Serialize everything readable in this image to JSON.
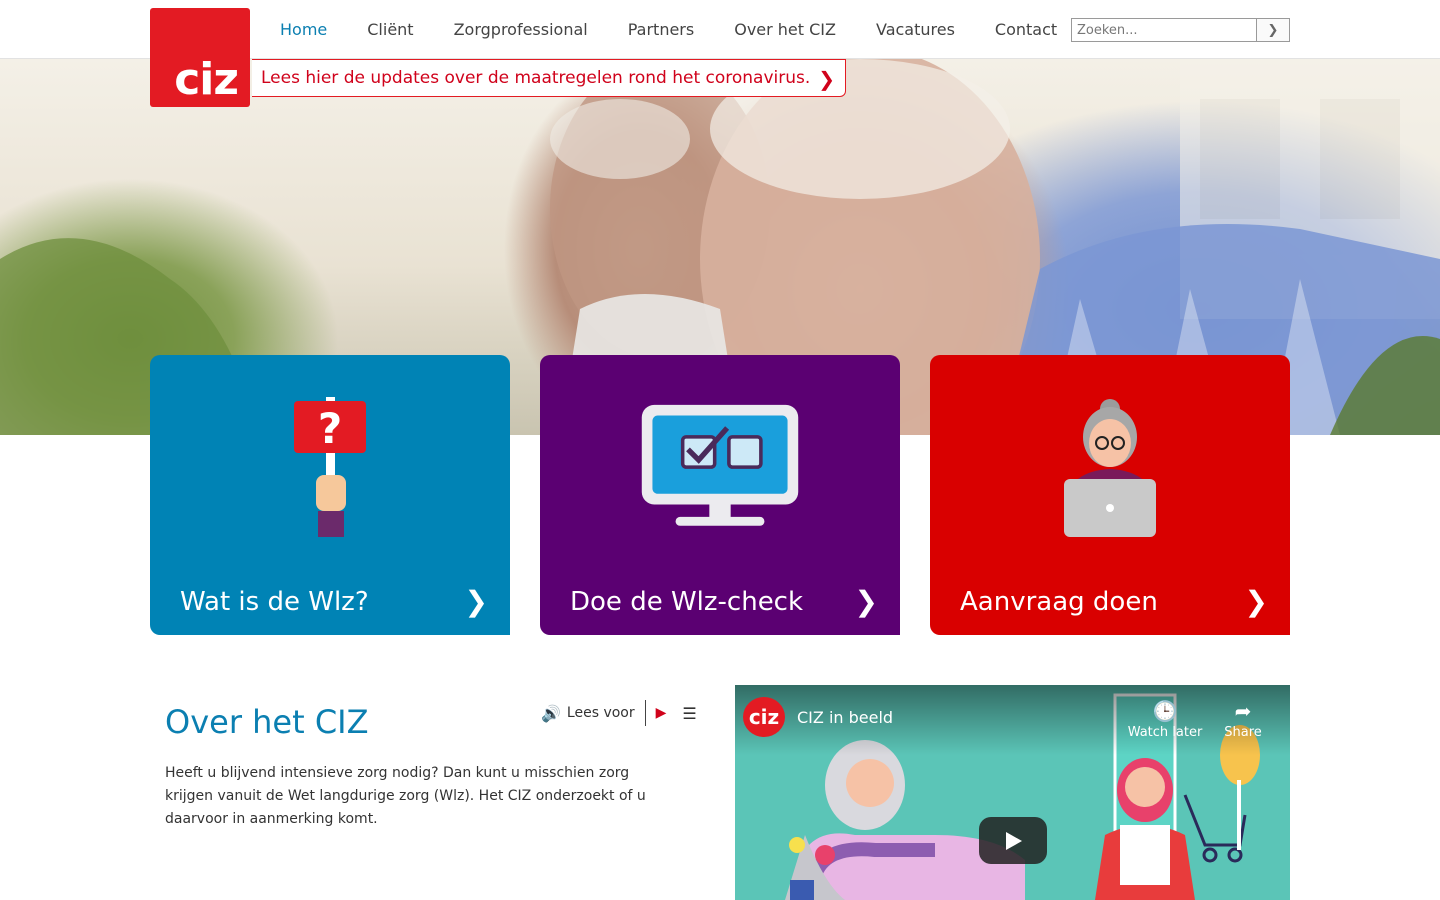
{
  "nav": {
    "items": [
      "Home",
      "Cliënt",
      "Zorgprofessional",
      "Partners",
      "Over het CIZ",
      "Vacatures",
      "Contact"
    ],
    "active": "Home"
  },
  "logo": {
    "text": "ciz"
  },
  "search": {
    "placeholder": "Zoeken..."
  },
  "banner": {
    "text": "Lees hier de updates over de maatregelen rond het coronavirus."
  },
  "tiles": [
    {
      "label": "Wat is de Wlz?",
      "color": "#0083b5",
      "icon": "question-sign-icon"
    },
    {
      "label": "Doe de Wlz-check",
      "color": "#5b0072",
      "icon": "monitor-checklist-icon"
    },
    {
      "label": "Aanvraag doen",
      "color": "#d90000",
      "icon": "woman-laptop-icon"
    }
  ],
  "about": {
    "title": "Over het CIZ",
    "body": "Heeft u blijvend intensieve zorg nodig? Dan kunt u misschien zorg krijgen vanuit de Wet langdurige zorg (Wlz). Het CIZ onderzoekt of u daarvoor in aanmerking komt.",
    "read_aloud": "Lees voor"
  },
  "video": {
    "channel_logo": "ciz",
    "title": "CIZ in beeld",
    "watch_later": "Watch later",
    "share": "Share"
  },
  "colors": {
    "brand_red": "#e31b23",
    "link_blue": "#0b7fb1",
    "purple": "#5b0072"
  }
}
